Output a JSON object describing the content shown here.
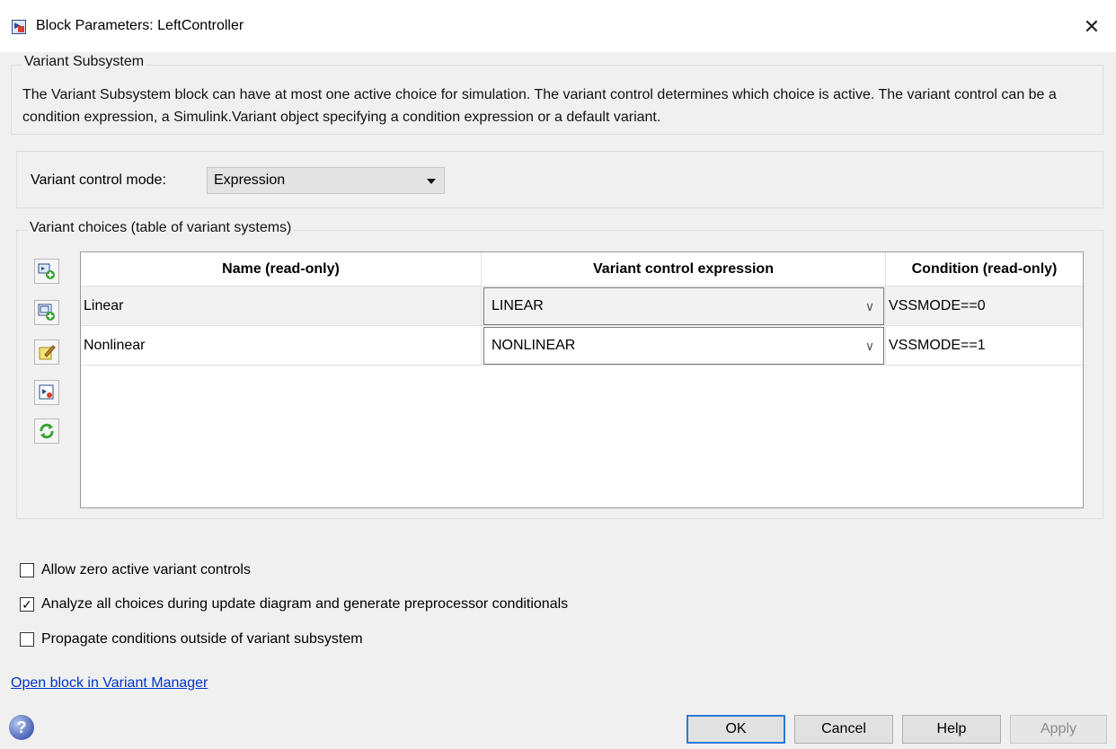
{
  "window": {
    "title": "Block Parameters: LeftController",
    "close_glyph": "✕"
  },
  "variant_subsystem": {
    "legend": "Variant Subsystem",
    "description": "The Variant Subsystem block can have at most one active choice for simulation. The variant control determines which choice is active. The variant control can be a condition expression, a Simulink.Variant object specifying a condition expression or a default variant."
  },
  "control_mode": {
    "label": "Variant control mode:",
    "value": "Expression"
  },
  "choices": {
    "legend": "Variant choices (table of variant systems)",
    "toolbar_icons": [
      "add-choice-icon",
      "add-subsystem-choice-icon",
      "edit-icon",
      "open-block-icon",
      "refresh-icon"
    ],
    "headers": [
      "Name (read-only)",
      "Variant control expression",
      "Condition (read-only)"
    ],
    "rows": [
      {
        "name": "Linear",
        "expression": "LINEAR",
        "condition": "VSSMODE==0"
      },
      {
        "name": "Nonlinear",
        "expression": "NONLINEAR",
        "condition": "VSSMODE==1"
      }
    ]
  },
  "options": [
    {
      "label": "Allow zero active variant controls",
      "checked": false
    },
    {
      "label": "Analyze all choices during update diagram and generate preprocessor conditionals",
      "checked": true
    },
    {
      "label": "Propagate conditions outside of variant subsystem",
      "checked": false
    }
  ],
  "link": "Open block in Variant Manager",
  "buttons": {
    "ok": "OK",
    "cancel": "Cancel",
    "help": "Help",
    "apply": "Apply"
  },
  "help_glyph": "?",
  "colors": {
    "link": "#0033cc",
    "accent": "#2b79d6",
    "background": "#f0f0f0"
  }
}
